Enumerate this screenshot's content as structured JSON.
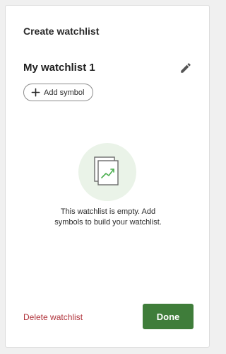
{
  "dialog": {
    "title": "Create watchlist"
  },
  "watchlist": {
    "name": "My watchlist 1",
    "edit_icon": "pencil-icon"
  },
  "add_symbol": {
    "label": "Add symbol",
    "icon": "plus-icon"
  },
  "empty_state": {
    "icon": "chart-document-icon",
    "line1": "This watchlist is empty. Add",
    "line2": "symbols to build your watchlist."
  },
  "footer": {
    "delete_label": "Delete watchlist",
    "done_label": "Done"
  },
  "colors": {
    "accent_green": "#3f7d3a",
    "danger_red": "#b0333b",
    "illustration_bg": "#eaf3e8",
    "chart_line": "#4caf50"
  }
}
